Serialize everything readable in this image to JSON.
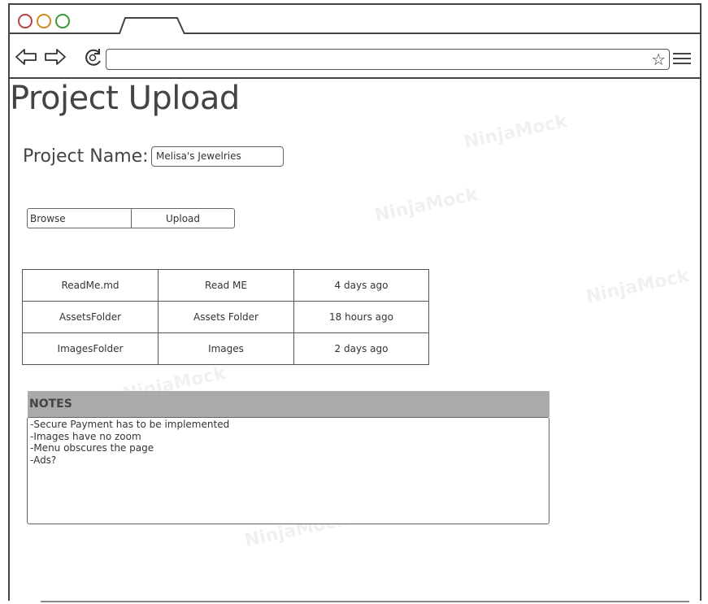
{
  "page": {
    "title": "Project Upload"
  },
  "project": {
    "label": "Project Name:",
    "value": "Melisa's Jewelries"
  },
  "upload": {
    "browse_label": "Browse",
    "upload_label": "Upload"
  },
  "files": {
    "rows": [
      {
        "file": "ReadMe.md",
        "description": "Read ME",
        "age": "4 days ago"
      },
      {
        "file": "AssetsFolder",
        "description": "Assets Folder",
        "age": "18 hours ago"
      },
      {
        "file": "ImagesFolder",
        "description": "Images",
        "age": "2 days ago"
      }
    ]
  },
  "notes": {
    "header": "NOTES",
    "lines": [
      "-Secure Payment has to be implemented",
      "-Images have no zoom",
      "-Menu obscures the page",
      "-Ads?"
    ]
  },
  "watermark": "NinjaMock",
  "colors": {
    "close": "#b54343",
    "minimize": "#d48a1f",
    "maximize": "#3a9a3a",
    "notes_header_bg": "#aaaaaa"
  }
}
